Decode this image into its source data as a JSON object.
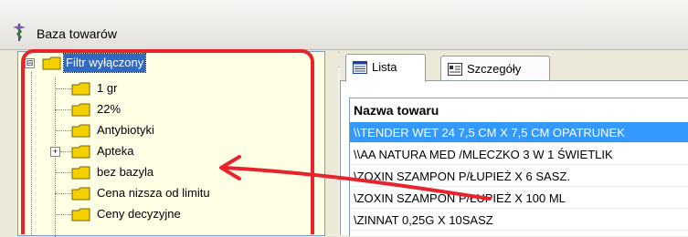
{
  "window": {
    "title": "Baza towarów",
    "app_icon": "pharmacy-caduceus-icon"
  },
  "tree": {
    "root_label": "Filtr wyłączony",
    "items": [
      {
        "label": "1 gr",
        "expandable": false
      },
      {
        "label": "22%",
        "expandable": false
      },
      {
        "label": "Antybiotyki",
        "expandable": false
      },
      {
        "label": "Apteka",
        "expandable": true
      },
      {
        "label": "bez bazyla",
        "expandable": false
      },
      {
        "label": "Cena nizsza od limitu",
        "expandable": false
      },
      {
        "label": "Ceny decyzyjne",
        "expandable": false
      }
    ]
  },
  "tabs": [
    {
      "label": "Lista",
      "icon": "list-view-icon",
      "active": true
    },
    {
      "label": "Szczegóły",
      "icon": "details-view-icon",
      "active": false
    }
  ],
  "grid": {
    "column_header": "Nazwa towaru",
    "rows": [
      "\\\\TENDER WET 24    7,5 CM X 7,5 CM OPATRUNEK",
      "\\\\AA NATURA MED /MLECZKO 3 W 1 ŚWIETLIK",
      "\\ZOXIN SZAMPON P/ŁUPIEŻ X 6  SASZ.",
      "\\ZOXIN SZAMPON P/ŁUPIEŻ X 100 ML",
      "\\ZINNAT 0,25G X 10SASZ"
    ],
    "selected_row": 0
  },
  "colors": {
    "selection": "#3399ff",
    "tree_selection": "#316ac5",
    "tree_background": "#ffffe6",
    "annotation": "#e8232b",
    "folder": "#f5d000"
  }
}
